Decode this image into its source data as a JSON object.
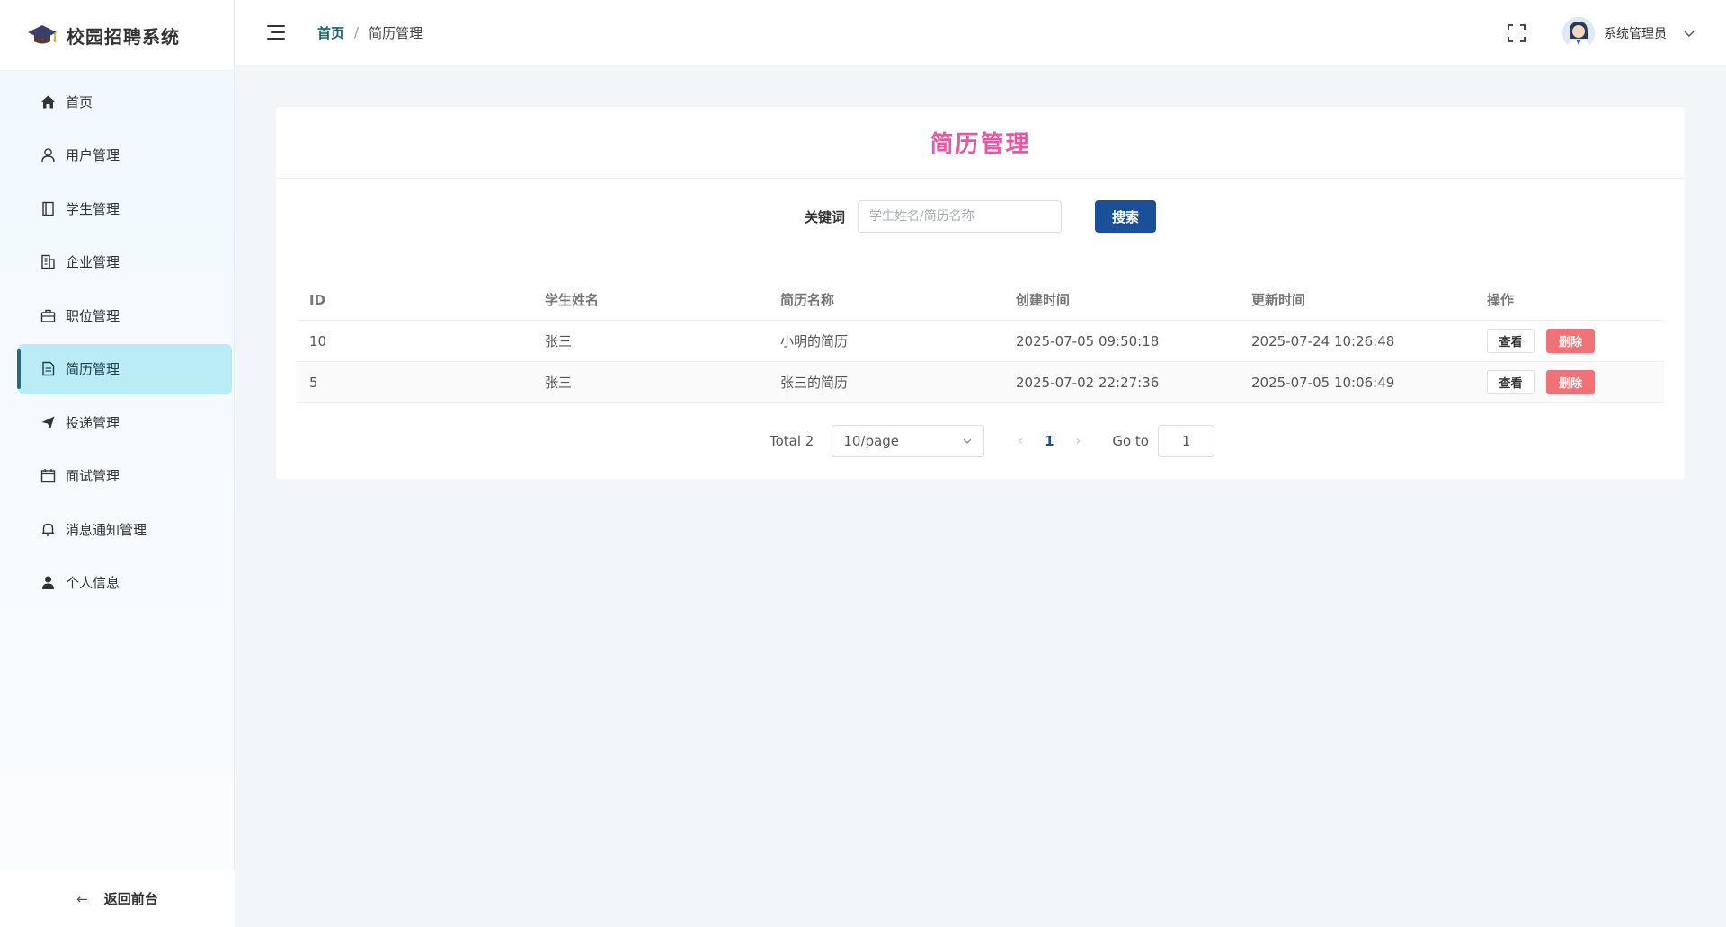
{
  "app": {
    "title": "校园招聘系统"
  },
  "sidebar": {
    "items": [
      {
        "label": "首页",
        "icon": "home-icon",
        "active": false
      },
      {
        "label": "用户管理",
        "icon": "user-icon",
        "active": false
      },
      {
        "label": "学生管理",
        "icon": "notebook-icon",
        "active": false
      },
      {
        "label": "企业管理",
        "icon": "building-icon",
        "active": false
      },
      {
        "label": "职位管理",
        "icon": "briefcase-icon",
        "active": false
      },
      {
        "label": "简历管理",
        "icon": "document-icon",
        "active": true
      },
      {
        "label": "投递管理",
        "icon": "send-icon",
        "active": false
      },
      {
        "label": "面试管理",
        "icon": "calendar-icon",
        "active": false
      },
      {
        "label": "消息通知管理",
        "icon": "bell-icon",
        "active": false
      },
      {
        "label": "个人信息",
        "icon": "person-icon",
        "active": false
      }
    ],
    "back_label": "返回前台"
  },
  "header": {
    "breadcrumb_home": "首页",
    "breadcrumb_sep": "/",
    "breadcrumb_current": "简历管理",
    "user_name": "系统管理员"
  },
  "page": {
    "title": "简历管理",
    "search": {
      "label": "关键词",
      "placeholder": "学生姓名/简历名称",
      "value": "",
      "button": "搜索"
    },
    "table": {
      "columns": [
        "ID",
        "学生姓名",
        "简历名称",
        "创建时间",
        "更新时间",
        "操作"
      ],
      "rows": [
        {
          "id": "10",
          "student": "张三",
          "resume": "小明的简历",
          "created": "2025-07-05 09:50:18",
          "updated": "2025-07-24 10:26:48"
        },
        {
          "id": "5",
          "student": "张三",
          "resume": "张三的简历",
          "created": "2025-07-02 22:27:36",
          "updated": "2025-07-05 10:06:49"
        }
      ],
      "view_label": "查看",
      "delete_label": "删除"
    },
    "pagination": {
      "total_text": "Total 2",
      "page_size": "10/page",
      "current_page": "1",
      "goto_label": "Go to",
      "goto_value": "1"
    }
  },
  "colors": {
    "accent": "#1b5099",
    "title_pink": "#e25aa3",
    "active_menu_bg": "#b9ecf4",
    "delete_red": "#f07176"
  }
}
